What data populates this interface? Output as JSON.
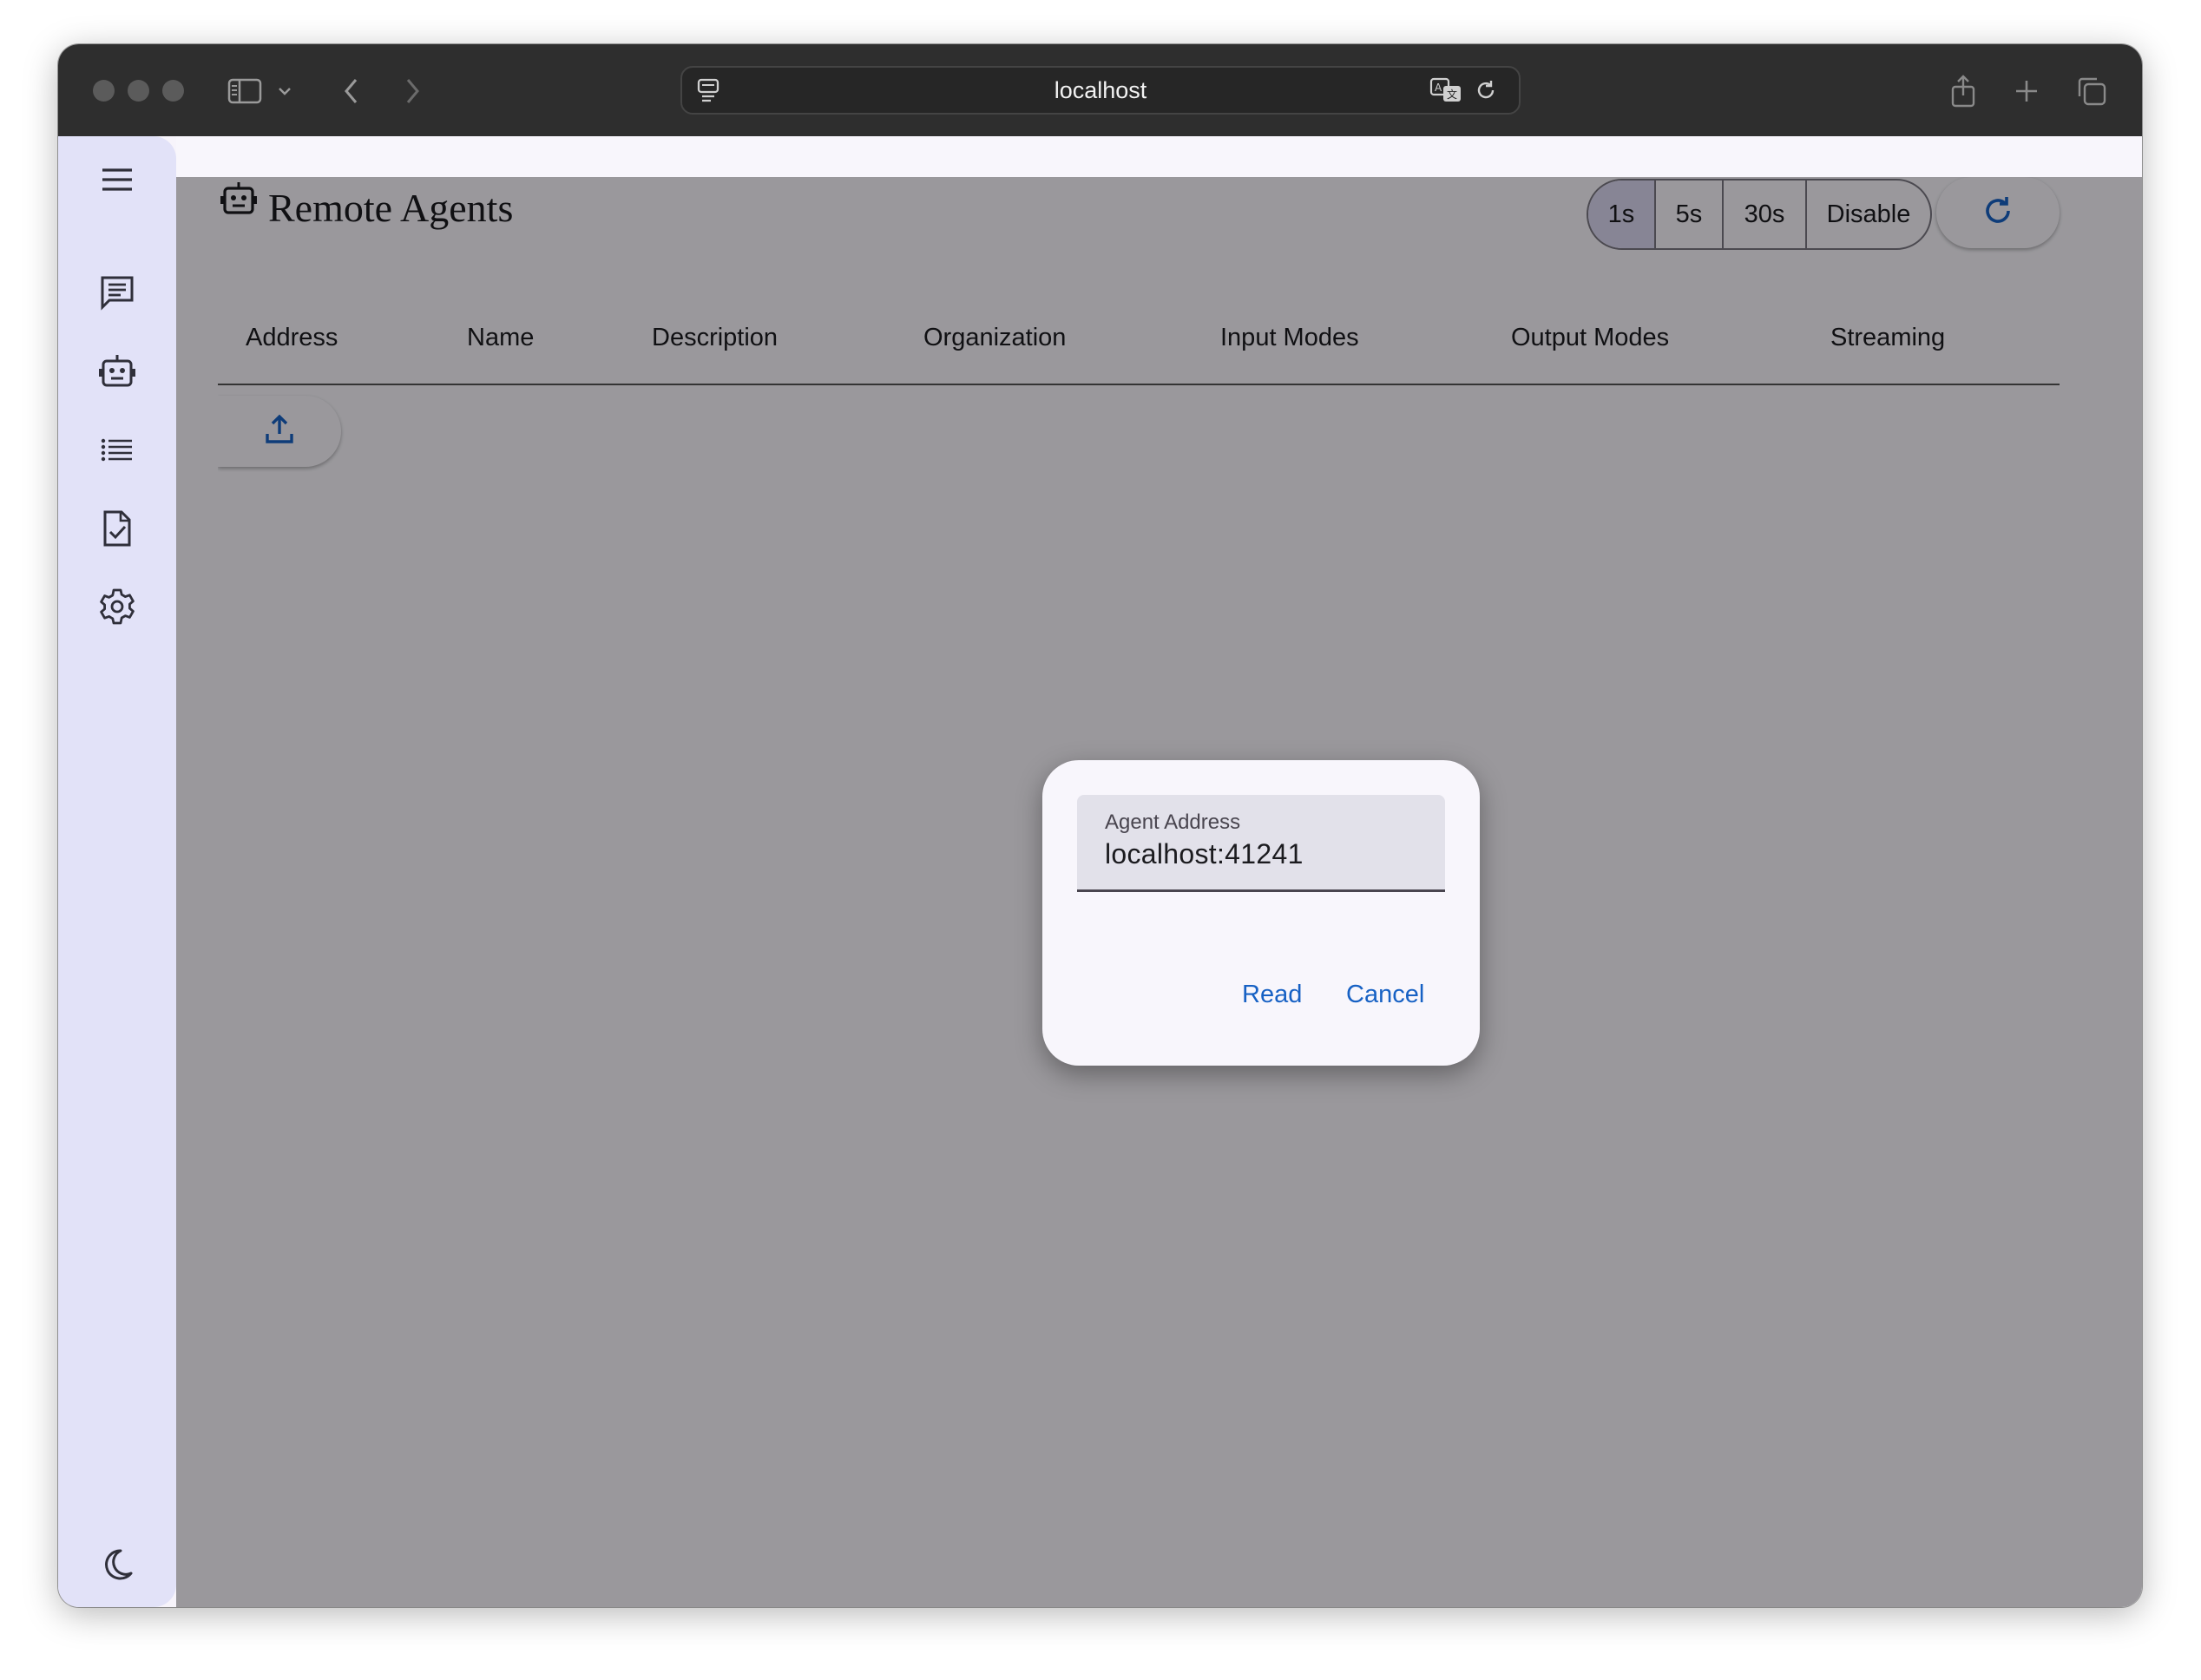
{
  "browser": {
    "url": "localhost",
    "icons": [
      "sidebar-toggle-icon",
      "chevron-down-icon",
      "back-icon",
      "forward-icon",
      "page-menu-icon",
      "translate-icon",
      "reload-icon",
      "share-icon",
      "new-tab-icon",
      "tabs-overview-icon"
    ]
  },
  "sidebar": {
    "items": [
      {
        "icon": "menu-icon"
      },
      {
        "icon": "chat-icon"
      },
      {
        "icon": "robot-icon"
      },
      {
        "icon": "list-icon"
      },
      {
        "icon": "task-icon"
      },
      {
        "icon": "settings-icon"
      }
    ],
    "footer_icon": "dark-mode-icon"
  },
  "page": {
    "title": "Remote Agents",
    "title_icon": "robot-icon",
    "refresh_intervals": [
      "1s",
      "5s",
      "30s",
      "Disable"
    ],
    "selected_interval": "1s",
    "refresh_icon": "refresh-icon",
    "upload_icon": "upload-icon"
  },
  "table": {
    "columns": [
      "Address",
      "Name",
      "Description",
      "Organization",
      "Input Modes",
      "Output Modes",
      "Streaming"
    ],
    "rows": []
  },
  "dialog": {
    "field_label": "Agent Address",
    "field_value": "localhost:41241",
    "read_label": "Read",
    "cancel_label": "Cancel"
  },
  "colors": {
    "accent": "#1761c4",
    "sidebar_bg": "#e2e2f8",
    "chrome_bg": "#2e2e2e",
    "selected_segment": "#dad7f0"
  }
}
